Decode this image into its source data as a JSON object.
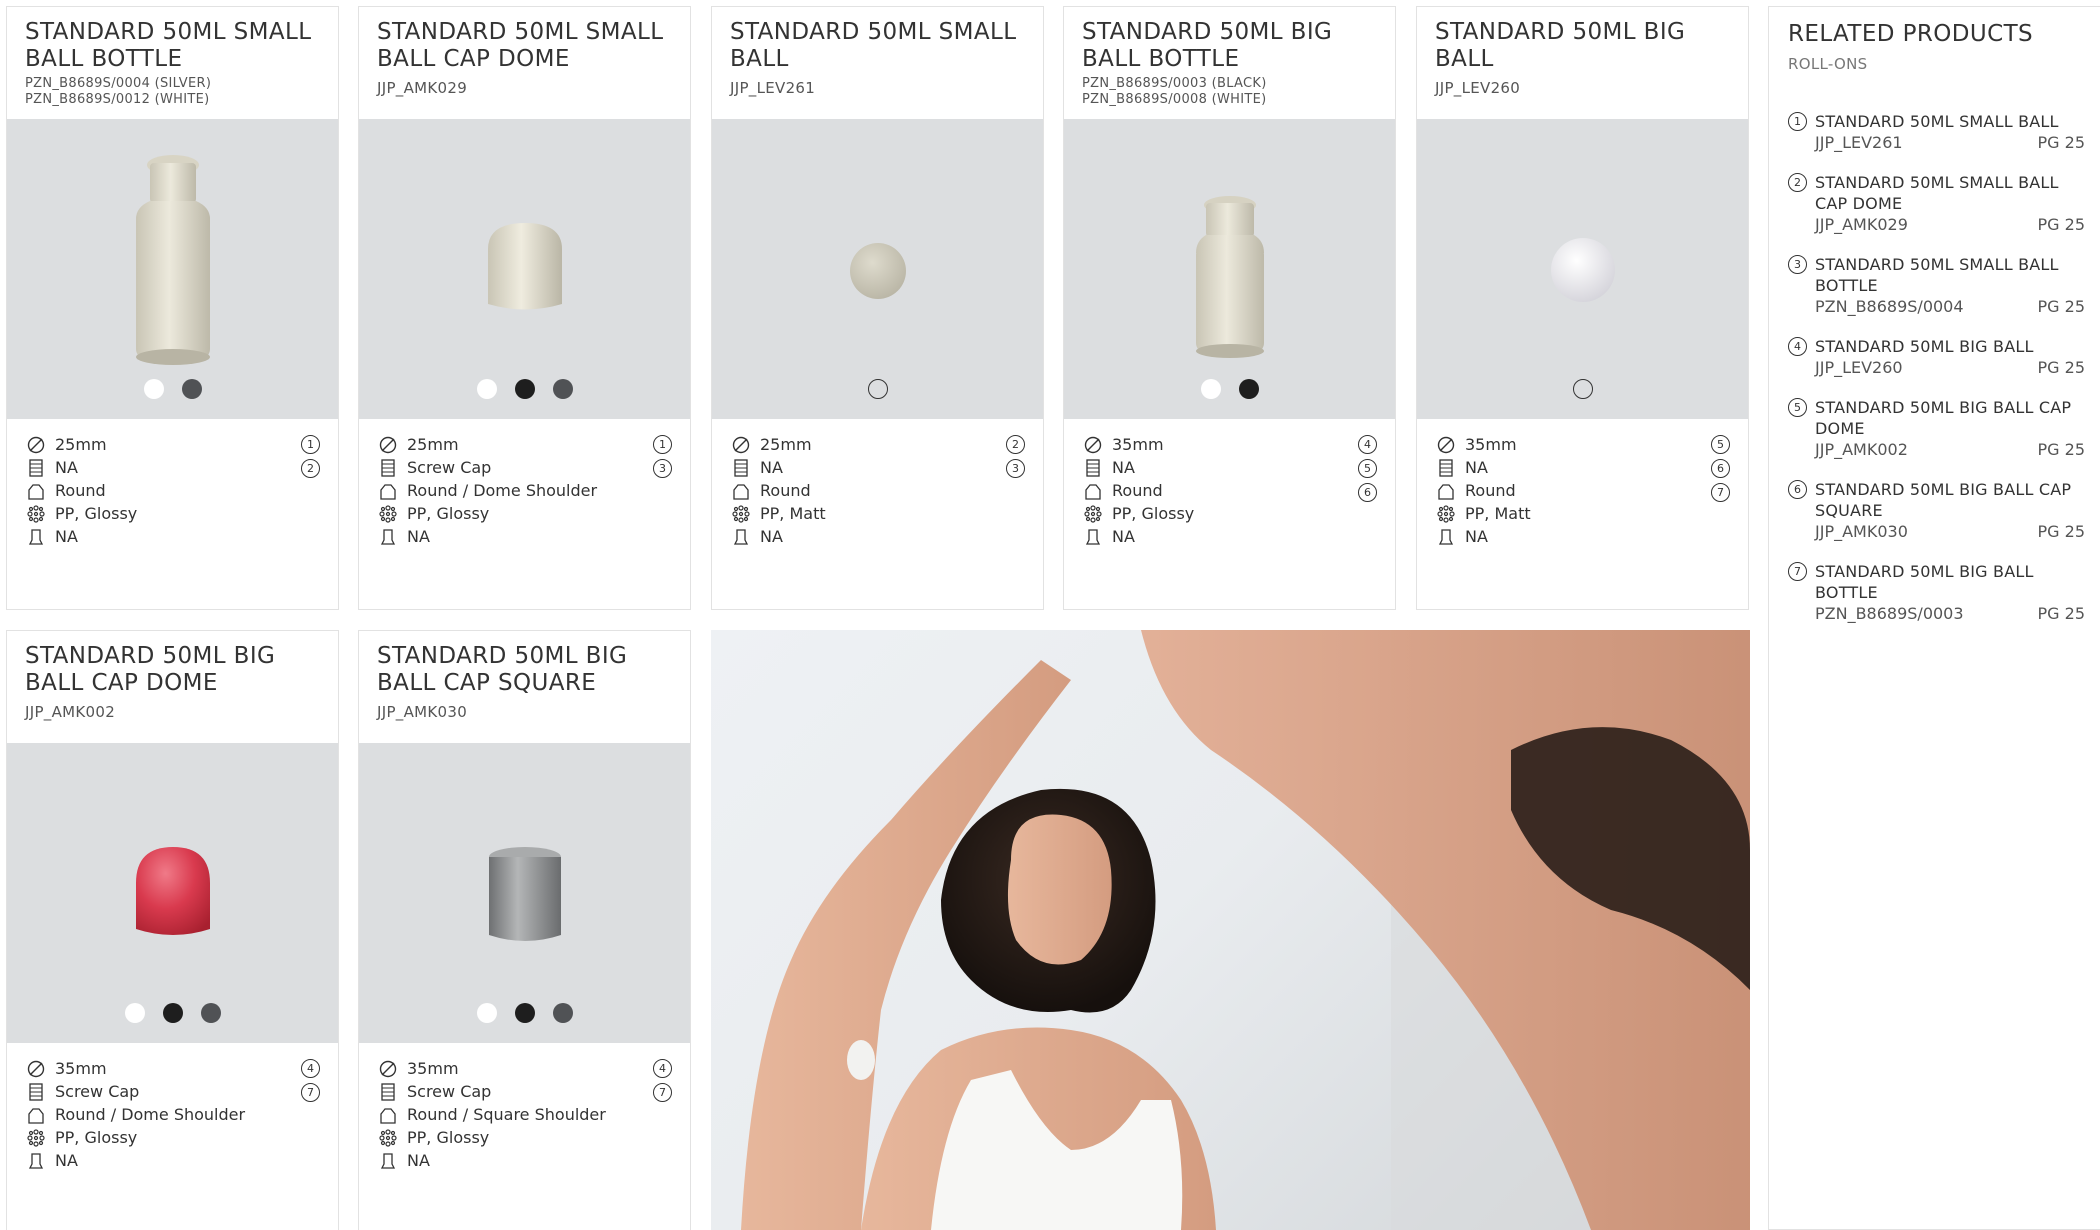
{
  "products": [
    {
      "title": "STANDARD 50ML SMALL BALL BOTTLE",
      "codes": [
        "PZN_B8689S/0004 (SILVER)",
        "PZN_B8689S/0012 (WHITE)"
      ],
      "size": "25mm",
      "closure": "NA",
      "shape": "Round",
      "material": "PP, Glossy",
      "decoration": "NA",
      "refs": [
        "1",
        "2"
      ]
    },
    {
      "title": "STANDARD 50ML SMALL BALL CAP DOME",
      "codes": [
        "JJP_AMK029"
      ],
      "size": "25mm",
      "closure": "Screw Cap",
      "shape": "Round / Dome Shoulder",
      "material": "PP, Glossy",
      "decoration": "NA",
      "refs": [
        "1",
        "3"
      ]
    },
    {
      "title": "STANDARD 50ML SMALL BALL",
      "codes": [
        "JJP_LEV261"
      ],
      "size": "25mm",
      "closure": "NA",
      "shape": "Round",
      "material": "PP, Matt",
      "decoration": "NA",
      "refs": [
        "2",
        "3"
      ]
    },
    {
      "title": "STANDARD 50ML BIG BALL BOTTLE",
      "codes": [
        "PZN_B8689S/0003 (BLACK)",
        "PZN_B8689S/0008 (WHITE)"
      ],
      "size": "35mm",
      "closure": "NA",
      "shape": "Round",
      "material": "PP, Glossy",
      "decoration": "NA",
      "refs": [
        "4",
        "5",
        "6"
      ]
    },
    {
      "title": "STANDARD 50ML BIG BALL",
      "codes": [
        "JJP_LEV260"
      ],
      "size": "35mm",
      "closure": "NA",
      "shape": "Round",
      "material": "PP, Matt",
      "decoration": "NA",
      "refs": [
        "5",
        "6",
        "7"
      ]
    },
    {
      "title": "STANDARD 50ML BIG BALL CAP DOME",
      "codes": [
        "JJP_AMK002"
      ],
      "size": "35mm",
      "closure": "Screw Cap",
      "shape": "Round / Dome Shoulder",
      "material": "PP, Glossy",
      "decoration": "NA",
      "refs": [
        "4",
        "7"
      ]
    },
    {
      "title": "STANDARD 50ML BIG BALL CAP SQUARE",
      "codes": [
        "JJP_AMK030"
      ],
      "size": "35mm",
      "closure": "Screw Cap",
      "shape": "Round / Square Shoulder",
      "material": "PP, Glossy",
      "decoration": "NA",
      "refs": [
        "4",
        "7"
      ]
    }
  ],
  "related": {
    "title": "RELATED PRODUCTS",
    "subtitle": "ROLL-ONS",
    "items": [
      {
        "num": "1",
        "name": "STANDARD 50ML SMALL BALL",
        "code": "JJP_LEV261",
        "page": "PG 25"
      },
      {
        "num": "2",
        "name": "STANDARD 50ML SMALL BALL CAP DOME",
        "code": "JJP_AMK029",
        "page": "PG 25"
      },
      {
        "num": "3",
        "name": "STANDARD 50ML SMALL BALL BOTTLE",
        "code": "PZN_B8689S/0004",
        "page": "PG 25"
      },
      {
        "num": "4",
        "name": "STANDARD 50ML BIG BALL",
        "code": "JJP_LEV260",
        "page": "PG 25"
      },
      {
        "num": "5",
        "name": "STANDARD 50ML BIG BALL CAP DOME",
        "code": "JJP_AMK002",
        "page": "PG 25"
      },
      {
        "num": "6",
        "name": "STANDARD 50ML BIG BALL CAP SQUARE",
        "code": "JJP_AMK030",
        "page": "PG 25"
      },
      {
        "num": "7",
        "name": "STANDARD 50ML BIG BALL BOTTLE",
        "code": "PZN_B8689S/0003",
        "page": "PG 25"
      }
    ]
  },
  "colors": {
    "photo_bg": "#dcdee0",
    "cap_red": "#d93a4e",
    "cap_silver": "#8f9192",
    "bottle_cream": "#e4e0d2"
  }
}
